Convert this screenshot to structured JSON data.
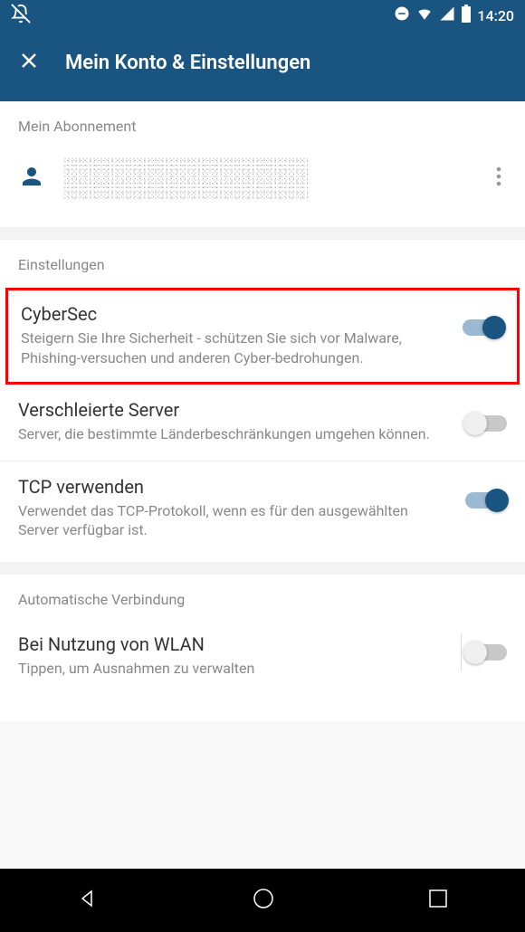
{
  "status": {
    "time": "14:20"
  },
  "header": {
    "title": "Mein Konto & Einstellungen"
  },
  "subscription": {
    "header": "Mein Abonnement"
  },
  "settings": {
    "header": "Einstellungen",
    "items": [
      {
        "title": "CyberSec",
        "desc": "Steigern Sie Ihre Sicherheit - schützen Sie sich vor Malware, Phishing-versuchen und anderen Cyber-bedrohungen.",
        "on": true,
        "highlighted": true
      },
      {
        "title": "Verschleierte Server",
        "desc": "Server, die bestimmte Länderbeschränkungen umgehen können.",
        "on": false
      },
      {
        "title": "TCP verwenden",
        "desc": "Verwendet das TCP-Protokoll, wenn es für den ausgewählten Server verfügbar ist.",
        "on": true
      }
    ]
  },
  "autoConnect": {
    "header": "Automatische Verbindung",
    "items": [
      {
        "title": "Bei Nutzung von WLAN",
        "desc": "Tippen, um Ausnahmen zu verwalten",
        "on": false
      }
    ]
  }
}
